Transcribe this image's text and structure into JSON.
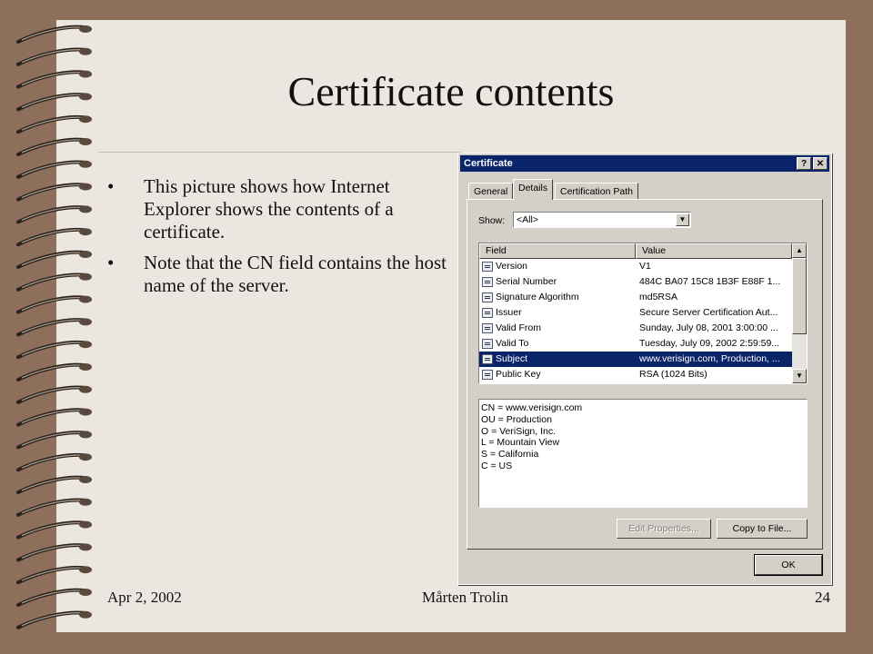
{
  "slide": {
    "title": "Certificate contents",
    "bullets": [
      "This picture shows how Internet Explorer shows the contents of a certificate.",
      "Note that the CN field contains the host name of the server."
    ],
    "bullet_glyph": "•",
    "footer": {
      "date": "Apr 2, 2002",
      "author": "Mårten Trolin",
      "page": "24"
    }
  },
  "dialog": {
    "title": "Certificate",
    "help_btn": "?",
    "close_btn": "✕",
    "tabs": [
      "General",
      "Details",
      "Certification Path"
    ],
    "active_tab": "Details",
    "show_label": "Show:",
    "show_value": "<All>",
    "columns": [
      "Field",
      "Value"
    ],
    "rows": [
      {
        "field": "Version",
        "value": "V1"
      },
      {
        "field": "Serial Number",
        "value": "484C BA07 15C8 1B3F E88F 1..."
      },
      {
        "field": "Signature Algorithm",
        "value": "md5RSA"
      },
      {
        "field": "Issuer",
        "value": "Secure Server Certification Aut..."
      },
      {
        "field": "Valid From",
        "value": "Sunday, July 08, 2001 3:00:00 ..."
      },
      {
        "field": "Valid To",
        "value": "Tuesday, July 09, 2002 2:59:59..."
      },
      {
        "field": "Subject",
        "value": "www.verisign.com, Production, ..."
      },
      {
        "field": "Public Key",
        "value": "RSA (1024 Bits)"
      }
    ],
    "selected_row": "Subject",
    "details": [
      "CN = www.verisign.com",
      "OU = Production",
      "O = VeriSign, Inc.",
      "L = Mountain View",
      "S = California",
      "C = US"
    ],
    "buttons": {
      "edit_properties": "Edit Properties...",
      "copy_to_file": "Copy to File...",
      "ok": "OK"
    }
  }
}
